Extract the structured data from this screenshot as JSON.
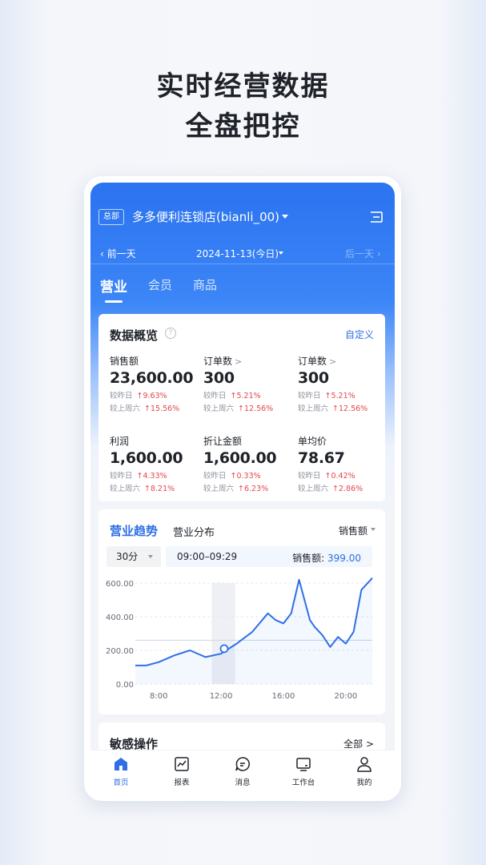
{
  "promo": {
    "line1": "实时经营数据",
    "line2": "全盘把控"
  },
  "header": {
    "badge": "总部",
    "store_name": "多多便利连锁店(bianli_00)",
    "prev_day": "前一天",
    "date": "2024-11-13(今日)",
    "next_day": "后一天"
  },
  "tabs": [
    "营业",
    "会员",
    "商品"
  ],
  "overview": {
    "title": "数据概览",
    "help": "?",
    "customize": "自定义",
    "metrics": [
      {
        "label": "销售额",
        "value": "23,600.00",
        "cmp1_label": "较昨日",
        "cmp1": "↑9.63%",
        "cmp2_label": "较上周六",
        "cmp2": "↑15.56%"
      },
      {
        "label": "订单数",
        "chevron": ">",
        "value": "300",
        "cmp1_label": "较昨日",
        "cmp1": "↑5.21%",
        "cmp2_label": "较上周六",
        "cmp2": "↑12.56%"
      },
      {
        "label": "订单数",
        "chevron": ">",
        "value": "300",
        "cmp1_label": "较昨日",
        "cmp1": "↑5.21%",
        "cmp2_label": "较上周六",
        "cmp2": "↑12.56%"
      },
      {
        "label": "利润",
        "value": "1,600.00",
        "cmp1_label": "较昨日",
        "cmp1": "↑4.33%",
        "cmp2_label": "较上周六",
        "cmp2": "↑8.21%"
      },
      {
        "label": "折让金额",
        "value": "1,600.00",
        "cmp1_label": "较昨日",
        "cmp1": "↑0.33%",
        "cmp2_label": "较上周六",
        "cmp2": "↑6.23%"
      },
      {
        "label": "单均价",
        "value": "78.67",
        "cmp1_label": "较昨日",
        "cmp1": "↑0.42%",
        "cmp2_label": "较上周六",
        "cmp2": "↑2.86%"
      }
    ]
  },
  "trend": {
    "tab_active": "营业趋势",
    "tab_other": "营业分布",
    "metric_select": "销售额",
    "interval": "30分",
    "selected_range": "09:00–09:29",
    "selected_label": "销售额: ",
    "selected_value": "399.00"
  },
  "chart_data": {
    "type": "line",
    "y_ticks": [
      "600.00",
      "400.00",
      "200.00",
      "0.00"
    ],
    "x_ticks": [
      "8:00",
      "12:00",
      "16:00",
      "20:00"
    ],
    "ylim": [
      0,
      600
    ],
    "xlim": [
      6.5,
      21.7
    ],
    "x": [
      6.5,
      7.2,
      8.0,
      9.0,
      10.0,
      11.0,
      12.0,
      12.5,
      13.0,
      14.0,
      15.0,
      15.5,
      16.0,
      16.5,
      17.0,
      17.7,
      18.0,
      18.5,
      19.0,
      19.5,
      20.0,
      20.5,
      21.0,
      21.7
    ],
    "values": [
      110,
      110,
      130,
      170,
      200,
      160,
      180,
      210,
      240,
      310,
      420,
      380,
      360,
      420,
      620,
      380,
      340,
      290,
      220,
      280,
      240,
      310,
      560,
      630
    ],
    "highlight_range": [
      11.4,
      12.9
    ],
    "marker_x": 12.2,
    "marker_y": 210,
    "reference_line": 260,
    "line_color": "#2f6fe6"
  },
  "sensitive": {
    "title": "敏感操作",
    "all": "全部 >"
  },
  "nav": [
    {
      "label": "首页",
      "icon": "home-icon",
      "active": true
    },
    {
      "label": "报表",
      "icon": "report-icon",
      "active": false
    },
    {
      "label": "消息",
      "icon": "message-icon",
      "active": false
    },
    {
      "label": "工作台",
      "icon": "workbench-icon",
      "active": false
    },
    {
      "label": "我的",
      "icon": "profile-icon",
      "active": false
    }
  ]
}
